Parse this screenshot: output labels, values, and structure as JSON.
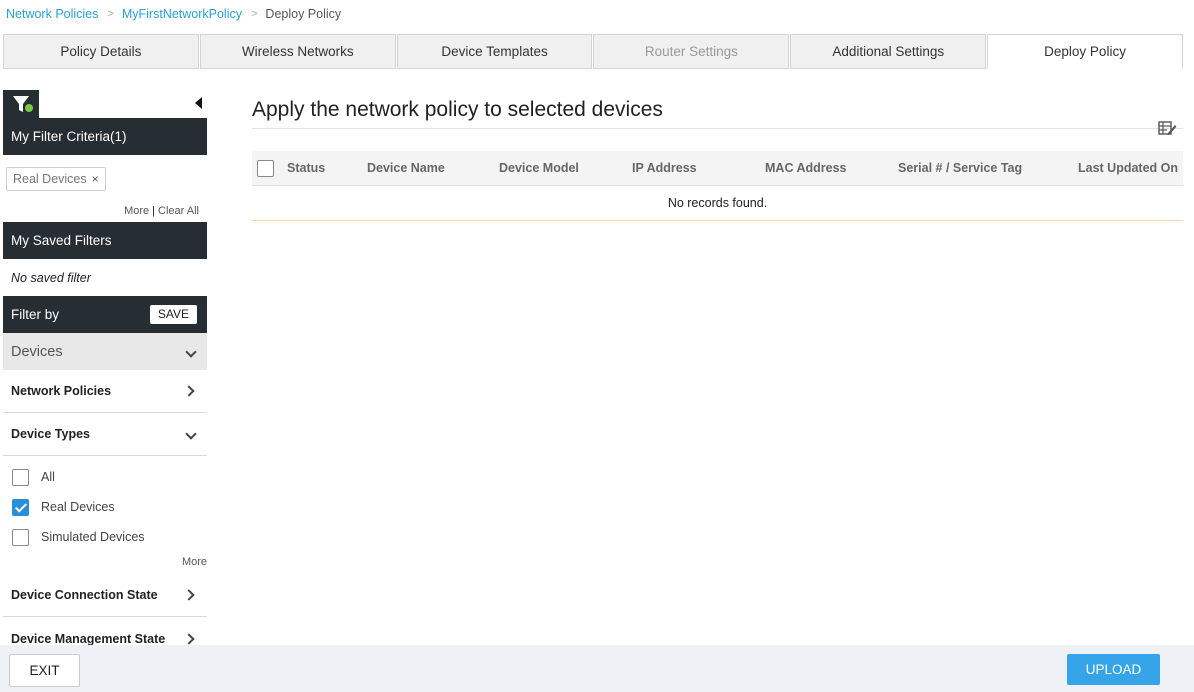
{
  "breadcrumb": {
    "items": [
      "Network Policies",
      "MyFirstNetworkPolicy"
    ],
    "current": "Deploy Policy"
  },
  "tabs": [
    {
      "label": "Policy Details",
      "state": "normal"
    },
    {
      "label": "Wireless Networks",
      "state": "normal"
    },
    {
      "label": "Device Templates",
      "state": "normal"
    },
    {
      "label": "Router Settings",
      "state": "disabled"
    },
    {
      "label": "Additional Settings",
      "state": "normal"
    },
    {
      "label": "Deploy Policy",
      "state": "active"
    }
  ],
  "sidebar": {
    "filter_criteria_title": "My Filter Criteria(1)",
    "chip_label": "Real Devices",
    "chip_remove": "×",
    "more_link": "More",
    "clear_all_link": "Clear All",
    "saved_filters_title": "My Saved Filters",
    "no_saved_text": "No saved filter",
    "filter_by_title": "Filter by",
    "save_button": "SAVE",
    "devices_label": "Devices",
    "sections": {
      "network_policies": "Network Policies",
      "device_types": "Device Types",
      "device_connection_state": "Device Connection State",
      "device_management_state": "Device Management State"
    },
    "device_types": [
      {
        "label": "All",
        "checked": false
      },
      {
        "label": "Real Devices",
        "checked": true
      },
      {
        "label": "Simulated Devices",
        "checked": false
      }
    ],
    "device_types_more": "More"
  },
  "main": {
    "title": "Apply the network policy to selected devices",
    "columns": [
      "Status",
      "Device Name",
      "Device Model",
      "IP Address",
      "MAC Address",
      "Serial # / Service Tag",
      "Last Updated On"
    ],
    "empty_message": "No records found."
  },
  "footer": {
    "exit_label": "EXIT",
    "upload_label": "UPLOAD"
  },
  "colors": {
    "link": "#2a9fd8",
    "dark_bar": "#262d33",
    "accent": "#35a4e8",
    "filter_dot": "#7ac943"
  }
}
